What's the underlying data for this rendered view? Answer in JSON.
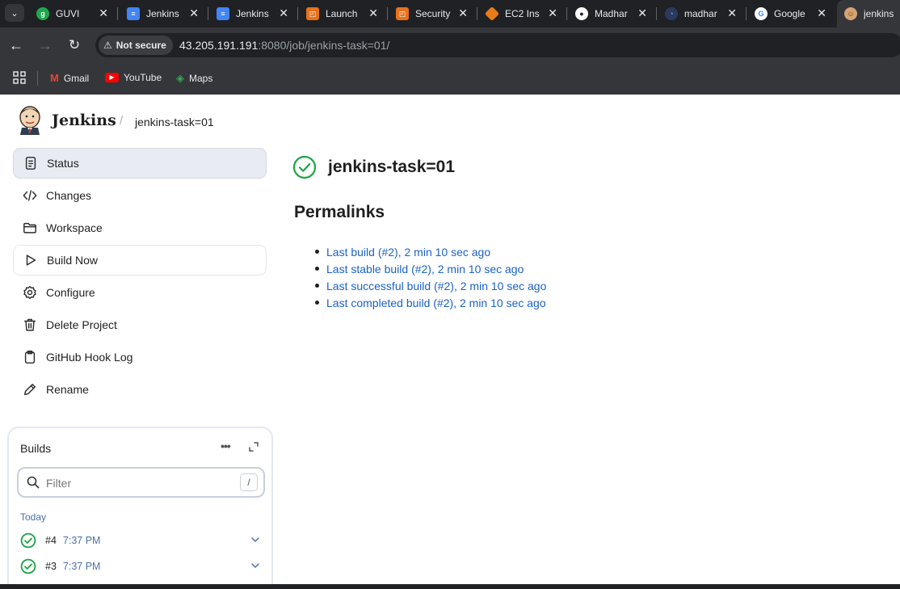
{
  "browser": {
    "tabs": [
      {
        "title": "GUVI",
        "favicon": "guvi-icon",
        "color": "#1da94c"
      },
      {
        "title": "Jenkins",
        "favicon": "google-docs-icon",
        "color": "#4285f4"
      },
      {
        "title": "Jenkins",
        "favicon": "google-docs-icon",
        "color": "#4285f4"
      },
      {
        "title": "Launch",
        "favicon": "aws-icon",
        "color": "#e8711b"
      },
      {
        "title": "Security",
        "favicon": "aws-icon",
        "color": "#e8711b"
      },
      {
        "title": "EC2 Ins",
        "favicon": "ec2-icon",
        "color": "#ea7b17"
      },
      {
        "title": "Madhar",
        "favicon": "github-icon",
        "color": "#ffffff"
      },
      {
        "title": "madhar",
        "favicon": "codeium-icon",
        "color": "#3d6fd6"
      },
      {
        "title": "Google",
        "favicon": "google-icon",
        "color": "#ffffff"
      },
      {
        "title": "jenkins",
        "favicon": "jenkins-icon",
        "color": "#d4a373"
      }
    ],
    "security_chip": "Not secure",
    "url_host": "43.205.191.191",
    "url_rest": ":8080/job/jenkins-task=01/",
    "bookmarks": [
      {
        "label": "Gmail",
        "icon": "gmail-icon"
      },
      {
        "label": "YouTube",
        "icon": "youtube-icon"
      },
      {
        "label": "Maps",
        "icon": "maps-icon"
      }
    ]
  },
  "header": {
    "brand": "Jenkins",
    "breadcrumb": "jenkins-task=01"
  },
  "sidebar": {
    "items": [
      {
        "label": "Status",
        "icon": "status-icon"
      },
      {
        "label": "Changes",
        "icon": "code-icon"
      },
      {
        "label": "Workspace",
        "icon": "folder-icon"
      },
      {
        "label": "Build Now",
        "icon": "play-icon"
      },
      {
        "label": "Configure",
        "icon": "gear-icon"
      },
      {
        "label": "Delete Project",
        "icon": "trash-icon"
      },
      {
        "label": "GitHub Hook Log",
        "icon": "clipboard-icon"
      },
      {
        "label": "Rename",
        "icon": "pencil-icon"
      }
    ]
  },
  "builds": {
    "title": "Builds",
    "more": "•••",
    "filter_placeholder": "Filter",
    "filter_shortcut": "/",
    "group": "Today",
    "rows": [
      {
        "number": "#4",
        "time": "7:37 PM"
      },
      {
        "number": "#3",
        "time": "7:37 PM"
      }
    ]
  },
  "main": {
    "job_title": "jenkins-task=01",
    "permalinks_title": "Permalinks",
    "permalinks": [
      "Last build (#2), 2 min 10 sec ago",
      "Last stable build (#2), 2 min 10 sec ago",
      "Last successful build (#2), 2 min 10 sec ago",
      "Last completed build (#2), 2 min 10 sec ago"
    ]
  },
  "colors": {
    "success": "#1ea446",
    "link": "#1b62c6",
    "chrome_dark": "#202124",
    "chrome_mid": "#35363a"
  }
}
